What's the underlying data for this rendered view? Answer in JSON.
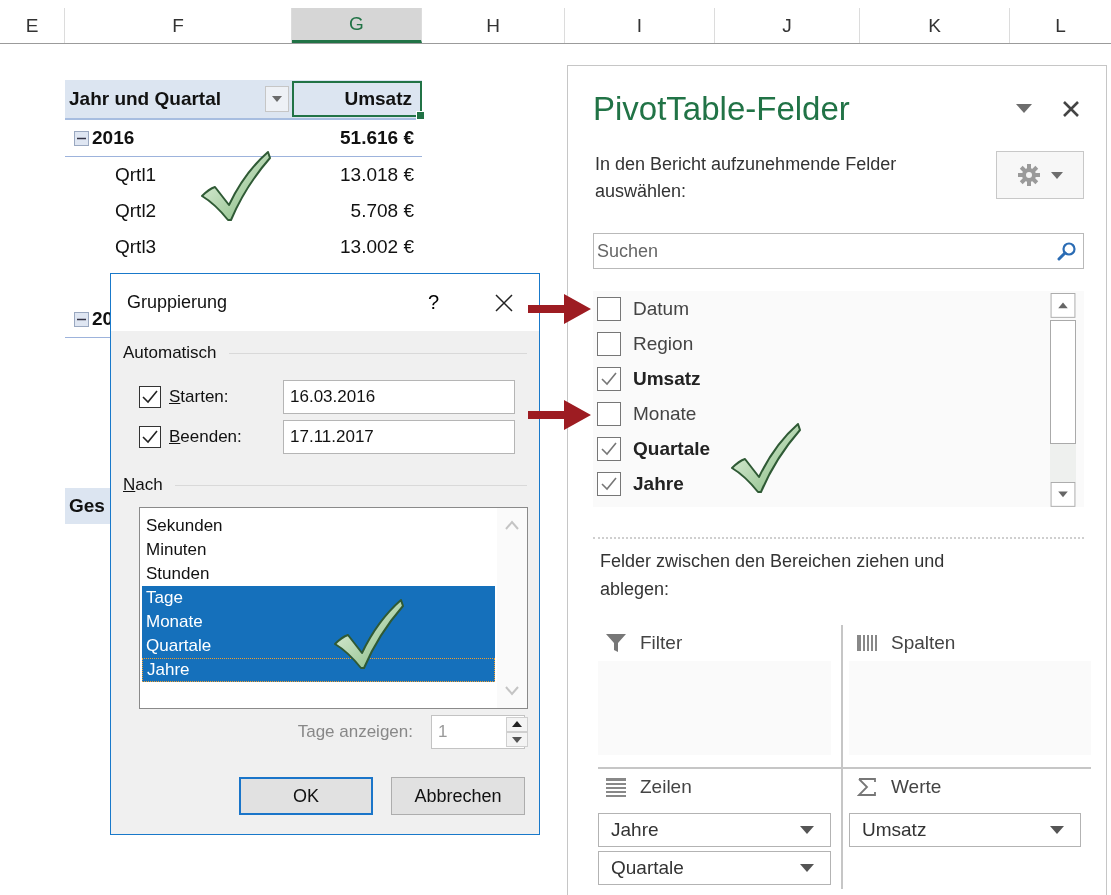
{
  "sheet": {
    "columns": [
      {
        "label": "E",
        "selected": false
      },
      {
        "label": "F",
        "selected": false
      },
      {
        "label": "G",
        "selected": true
      },
      {
        "label": "H",
        "selected": false
      },
      {
        "label": "I",
        "selected": false
      },
      {
        "label": "J",
        "selected": false
      },
      {
        "label": "K",
        "selected": false
      },
      {
        "label": "L",
        "selected": false
      }
    ],
    "pivot": {
      "row_header": "Jahr und Quartal",
      "value_header": "Umsatz",
      "value_header_selected": true,
      "rows": [
        {
          "kind": "year",
          "label": "2016",
          "value": "51.616 €",
          "expanded": true
        },
        {
          "kind": "quarter",
          "label": "Qrtl1",
          "value": "13.018 €"
        },
        {
          "kind": "quarter",
          "label": "Qrtl2",
          "value": "5.708 €"
        },
        {
          "kind": "quarter",
          "label": "Qrtl3",
          "value": "13.002 €"
        },
        {
          "kind": "year",
          "label": "20",
          "expanded": true
        },
        {
          "kind": "total",
          "label": "Ges"
        }
      ]
    }
  },
  "dialog": {
    "title": "Gruppierung",
    "help": "?",
    "automatic": {
      "heading": "Automatisch",
      "fields": [
        {
          "label": "Starten:",
          "underline_first": true,
          "checked": true,
          "value": "16.03.2016"
        },
        {
          "label": "Beenden:",
          "underline_first": true,
          "checked": true,
          "value": "17.11.2017"
        }
      ]
    },
    "by": {
      "heading": "Nach",
      "underline_first": true,
      "items": [
        {
          "label": "Sekunden",
          "selected": false,
          "focused": false
        },
        {
          "label": "Minuten",
          "selected": false,
          "focused": false
        },
        {
          "label": "Stunden",
          "selected": false,
          "focused": false
        },
        {
          "label": "Tage",
          "selected": true,
          "focused": false
        },
        {
          "label": "Monate",
          "selected": true,
          "focused": false
        },
        {
          "label": "Quartale",
          "selected": true,
          "focused": false
        },
        {
          "label": "Jahre",
          "selected": true,
          "focused": true
        }
      ]
    },
    "days": {
      "label": "Tage anzeigen:",
      "value": "1",
      "disabled": true
    },
    "buttons": [
      {
        "label": "OK",
        "default": true
      },
      {
        "label": "Abbrechen",
        "default": false
      }
    ]
  },
  "pane": {
    "title": "PivotTable-Felder",
    "instructions": "In den Bericht aufzunehmende Felder auswählen:",
    "search": {
      "placeholder": "Suchen"
    },
    "fields": [
      {
        "label": "Datum",
        "checked": false
      },
      {
        "label": "Region",
        "checked": false
      },
      {
        "label": "Umsatz",
        "checked": true
      },
      {
        "label": "Monate",
        "checked": false
      },
      {
        "label": "Quartale",
        "checked": true
      },
      {
        "label": "Jahre",
        "checked": true
      }
    ],
    "areas_instructions": "Felder zwischen den Bereichen ziehen und ablegen:",
    "areas": [
      {
        "kind": "filter",
        "label": "Filter"
      },
      {
        "kind": "columns",
        "label": "Spalten"
      },
      {
        "kind": "rows",
        "label": "Zeilen",
        "items": [
          "Jahre",
          "Quartale"
        ]
      },
      {
        "kind": "values",
        "label": "Werte",
        "items": [
          "Umsatz"
        ]
      }
    ]
  }
}
